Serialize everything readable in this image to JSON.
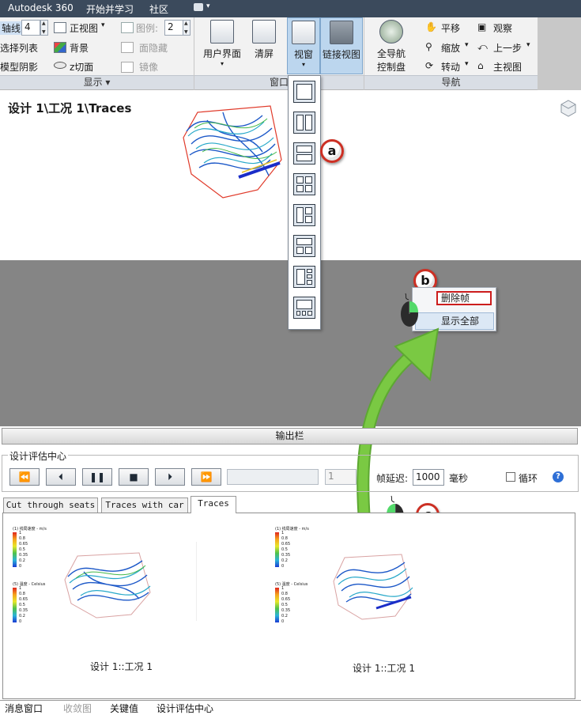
{
  "menubar": {
    "items": [
      "Autodesk 360",
      "开始并学习",
      "社区"
    ]
  },
  "ribbon": {
    "display": {
      "axis_label": "轴线:",
      "axis_value": "4",
      "ortho_label": "正视图",
      "select_list_label": "选择列表",
      "background_label": "背景",
      "model_shadow_label": "模型阴影",
      "zcut_label": "z切面",
      "legend_label": "图例:",
      "legend_value": "2",
      "hide_label": "面隐藏",
      "mirror_label": "镜像",
      "title": "显示"
    },
    "window": {
      "user_interface_label": "用户界面",
      "clear_label": "清屏",
      "viewport_label": "视窗",
      "link_views_label": "链接视图",
      "title": "窗口"
    },
    "nav": {
      "full_nav_label_1": "全导航",
      "full_nav_label_2": "控制盘",
      "pan_label": "平移",
      "zoom_label": "缩放",
      "rotate_label": "转动",
      "observe_label": "观察",
      "prev_label": "上一步",
      "home_label": "主视图",
      "title": "导航"
    }
  },
  "viewport": {
    "title": "设计 1\\工况 1\\Traces"
  },
  "callouts": {
    "a": "a",
    "b": "b",
    "c": "c"
  },
  "context_menu": {
    "delete_frame": "删除帧",
    "show_all": "显示全部"
  },
  "output_bar": {
    "label": "输出栏"
  },
  "decision_center": {
    "title": "设计评估中心",
    "frame_value": "1",
    "delay_label": "帧延迟:",
    "delay_value": "1000",
    "ms_label": "毫秒",
    "loop_label": "循环",
    "help_symbol": "?",
    "tabs": [
      "Cut through seats",
      "Traces with car",
      "Traces"
    ],
    "active_tab": "Traces",
    "thumbnails": [
      {
        "caption": "设计 1::工况 1",
        "legend1_title": "(1) 线局速度 - m/s",
        "legend2_title": "(5) 温度 - Celsius",
        "legend1_ticks": [
          "1",
          "0.8",
          "0.65",
          "0.5",
          "0.35",
          "0.2",
          "0"
        ],
        "legend2_ticks": [
          "1",
          "0.8",
          "0.65",
          "0.5",
          "0.35",
          "0.2",
          "0"
        ]
      },
      {
        "caption": "设计 1::工况 1",
        "legend1_title": "(1) 线局速度 - m/s",
        "legend2_title": "(5) 温度 - Celsius",
        "legend1_ticks": [
          "1",
          "0.8",
          "0.65",
          "0.5",
          "0.35",
          "0.2",
          "0"
        ],
        "legend2_ticks": [
          "1",
          "0.8",
          "0.65",
          "0.5",
          "0.35",
          "0.2",
          "0"
        ]
      }
    ]
  },
  "bottom_tabs": [
    "消息窗口",
    "收敛图",
    "关键值",
    "设计评估中心"
  ],
  "colors": {
    "menubar": "#3b4a5c",
    "callout_ring": "#cc2f23",
    "arrow": "#7ac943",
    "highlight": "#cc1d1d"
  }
}
